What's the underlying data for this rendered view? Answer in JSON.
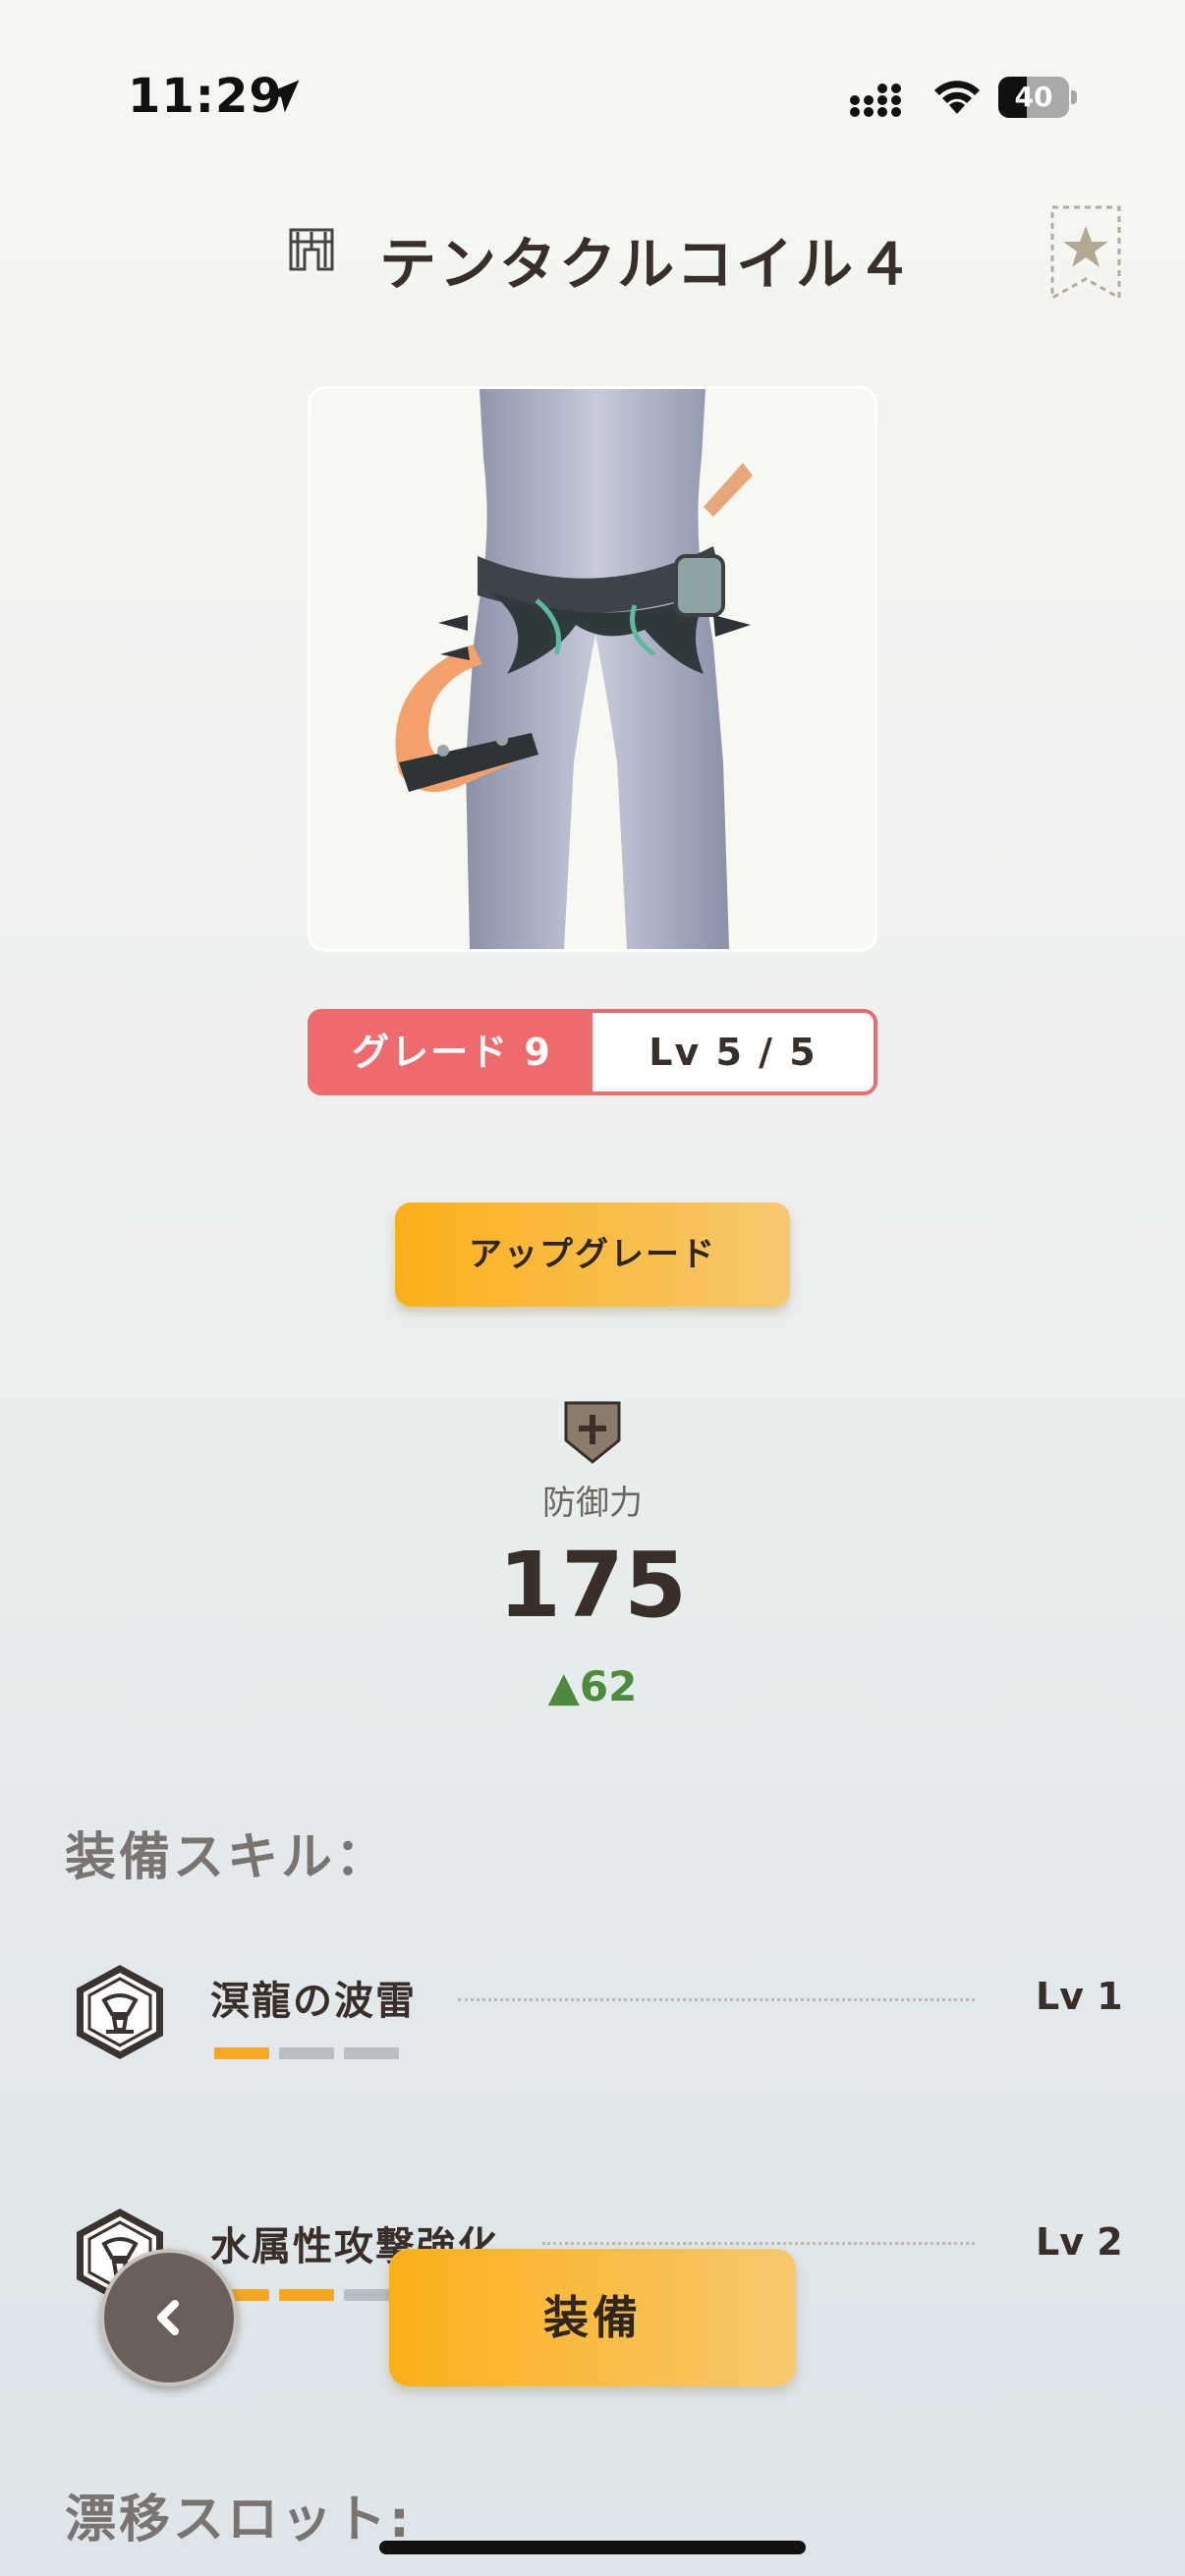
{
  "status_bar": {
    "time": "11:29",
    "battery": "40",
    "battery_level": 0.4
  },
  "header": {
    "title": "テンタクルコイル４",
    "category_icon": "waist-armor-icon",
    "favorite_icon": "star-bookmark-icon"
  },
  "grade": {
    "grade_label": "グレード 9",
    "level_label": "Lv 5 / 5"
  },
  "upgrade_button": "アップグレード",
  "defense": {
    "label": "防御力",
    "value": "175",
    "delta": "▲62",
    "icon": "shield-icon"
  },
  "skills_section": {
    "title": "装備スキル：",
    "skills": [
      {
        "name": "溟龍の波雷",
        "level": "Lv 1",
        "level_value": 1,
        "max_level": 3
      },
      {
        "name": "水属性攻撃強化",
        "level": "Lv 2",
        "level_value": 2,
        "max_level": 5
      }
    ]
  },
  "slots_section": {
    "title": "漂移スロット:"
  },
  "bottom": {
    "equip_button": "装備",
    "back_icon": "chevron-left-icon"
  },
  "colors": {
    "accent": "#fbb019",
    "grade": "#ef6a6c",
    "delta": "#4b8b3b",
    "segment_on": "#f5a623",
    "segment_off": "#b8bec3"
  }
}
